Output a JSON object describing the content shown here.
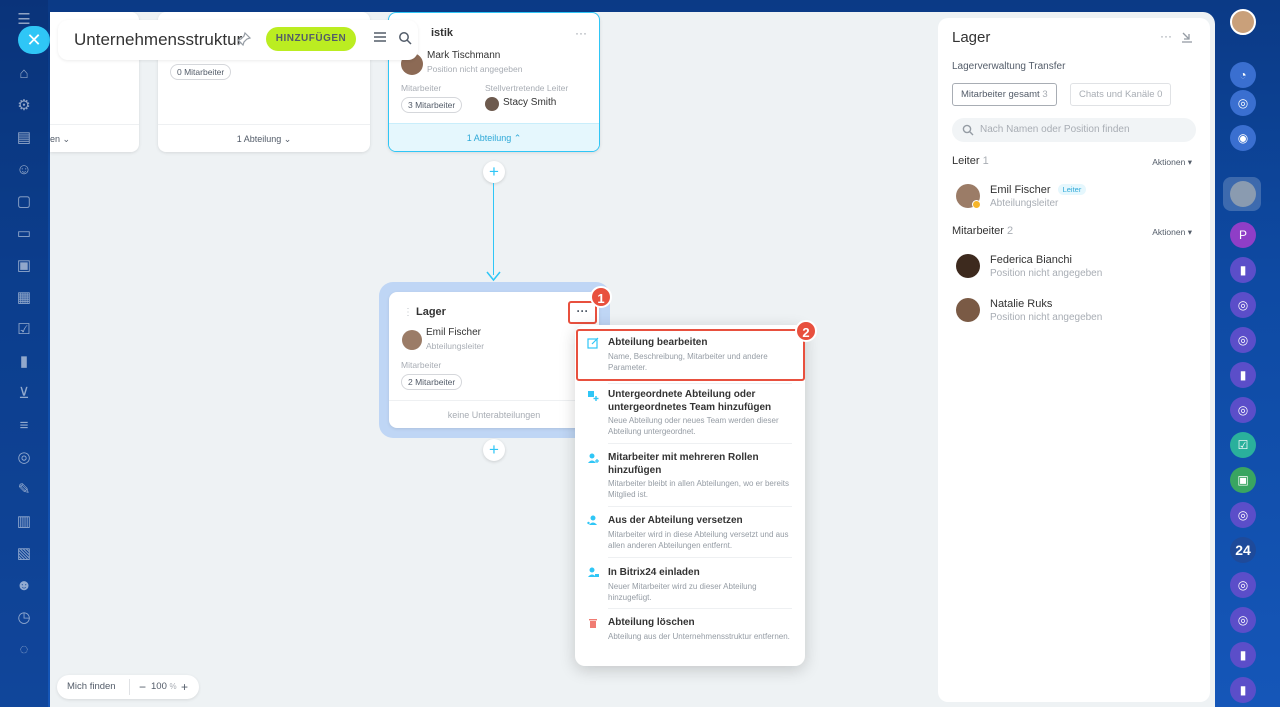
{
  "header": {
    "title": "Unternehmensstruktur",
    "add_button": "HINZUFÜGEN"
  },
  "cards": {
    "left_partial": {
      "footer": "en"
    },
    "second": {
      "pill": "0 Mitarbeiter",
      "footer": "1 Abteilung"
    },
    "logistik": {
      "title": "istik",
      "head_name": "Mark Tischmann",
      "head_position": "Position nicht angegeben",
      "employees_label": "Mitarbeiter",
      "employees_pill": "3 Mitarbeiter",
      "deputy_label": "Stellvertretende Leiter",
      "deputy_name": "Stacy Smith",
      "footer": "1 Abteilung"
    },
    "lager": {
      "title": "Lager",
      "head_name": "Emil Fischer",
      "head_position": "Abteilungsleiter",
      "employees_label": "Mitarbeiter",
      "employees_pill": "2 Mitarbeiter",
      "footer": "keine Unterabteilungen"
    }
  },
  "callouts": {
    "one": "1",
    "two": "2"
  },
  "dropdown": {
    "items": [
      {
        "title": "Abteilung bearbeiten",
        "desc": "Name, Beschreibung, Mitarbeiter und andere Parameter."
      },
      {
        "title": "Untergeordnete Abteilung oder untergeordnetes Team hinzufügen",
        "desc": "Neue Abteilung oder neues Team werden dieser Abteilung untergeordnet."
      },
      {
        "title": "Mitarbeiter mit mehreren Rollen hinzufügen",
        "desc": "Mitarbeiter bleibt in allen Abteilungen, wo er bereits Mitglied ist."
      },
      {
        "title": "Aus der Abteilung versetzen",
        "desc": "Mitarbeiter wird in diese Abteilung versetzt und aus allen anderen Abteilungen entfernt."
      },
      {
        "title": "In Bitrix24 einladen",
        "desc": "Neuer Mitarbeiter wird zu dieser Abteilung hinzugefügt."
      },
      {
        "title": "Abteilung löschen",
        "desc": "Abteilung aus der Unternehmensstruktur entfernen."
      }
    ]
  },
  "panel": {
    "title": "Lager",
    "subtitle": "Lagerverwaltung Transfer",
    "tab_employees": "Mitarbeiter gesamt",
    "tab_employees_count": "3",
    "tab_chats": "Chats und Kanäle",
    "tab_chats_count": "0",
    "search_placeholder": "Nach Namen oder Position finden",
    "leader_heading": "Leiter",
    "leader_count": "1",
    "employees_heading": "Mitarbeiter",
    "employees_count": "2",
    "actions_label": "Aktionen",
    "leader": {
      "name": "Emil Fischer",
      "badge": "Leiter",
      "position": "Abteilungsleiter"
    },
    "members": [
      {
        "name": "Federica Bianchi",
        "position": "Position nicht angegeben"
      },
      {
        "name": "Natalie Ruks",
        "position": "Position nicht angegeben"
      }
    ]
  },
  "zoom": {
    "find_me": "Mich finden",
    "value": "100",
    "unit": "%"
  },
  "right_rail": {
    "b24_label": "24"
  },
  "colors": {
    "accent": "#2fc6f6",
    "add_button": "#bbed21",
    "callout": "#e8503e"
  }
}
